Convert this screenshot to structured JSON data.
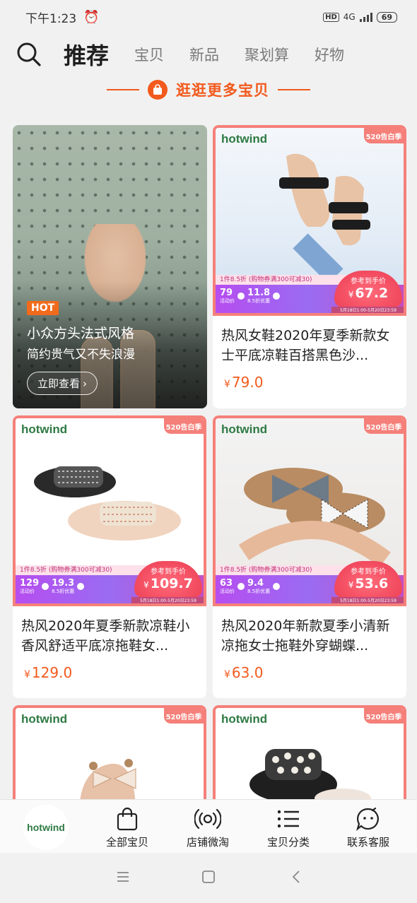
{
  "status_bar": {
    "time": "下午1:23",
    "network_label": "HD",
    "network_type": "4G",
    "battery": "69"
  },
  "header": {
    "tabs": [
      {
        "label": "推荐",
        "active": true
      },
      {
        "label": "宝贝",
        "active": false
      },
      {
        "label": "新品",
        "active": false
      },
      {
        "label": "聚划算",
        "active": false
      },
      {
        "label": "好物",
        "active": false
      }
    ]
  },
  "banner": {
    "text": "逛逛更多宝贝",
    "accent": "#f25a1d"
  },
  "hero": {
    "badge": "HOT",
    "title": "小众方头法式风格",
    "subtitle": "简约贵气又不失浪漫",
    "button": "立即查看"
  },
  "products": [
    {
      "brand": "hotwind",
      "tag": "520告白季",
      "promo_note": "1件8.5折 (购物券满300可减30)",
      "promo_a": "79",
      "promo_a_label": "活动价",
      "promo_b": "11.8",
      "promo_b_label": "8.5折优惠",
      "ref_label": "参考到手价",
      "ref_price": "67.2",
      "promo_date": "5月18日1:00-5月20日23:59",
      "title": "热风女鞋2020年夏季新款女士平底凉鞋百搭黑色沙...",
      "price": "79.0",
      "currency": "¥"
    },
    {
      "brand": "hotwind",
      "tag": "520告白季",
      "promo_note": "1件8.5折 (购物券满300可减30)",
      "promo_a": "129",
      "promo_a_label": "活动价",
      "promo_b": "19.3",
      "promo_b_label": "8.5折优惠",
      "ref_label": "参考到手价",
      "ref_price": "109.7",
      "promo_date": "5月18日1:00-5月20日23:59",
      "title": "热风2020年夏季新款凉鞋小香风舒适平底凉拖鞋女...",
      "price": "129.0",
      "currency": "¥"
    },
    {
      "brand": "hotwind",
      "tag": "520告白季",
      "promo_note": "1件8.5折 (购物券满300可减30)",
      "promo_a": "63",
      "promo_a_label": "活动价",
      "promo_b": "9.4",
      "promo_b_label": "8.5折优惠",
      "ref_label": "参考到手价",
      "ref_price": "53.6",
      "promo_date": "5月18日1:00-5月20日23:59",
      "title": "热风2020年新款夏季小清新凉拖女士拖鞋外穿蝴蝶...",
      "price": "63.0",
      "currency": "¥"
    },
    {
      "brand": "hotwind",
      "tag": "520告白季"
    },
    {
      "brand": "hotwind",
      "tag": "520告白季"
    }
  ],
  "bottom_nav": {
    "shop_logo": "hotwind",
    "items": [
      {
        "label": "全部宝贝",
        "icon": "shopping-bag-icon"
      },
      {
        "label": "店铺微淘",
        "icon": "broadcast-icon"
      },
      {
        "label": "宝贝分类",
        "icon": "list-icon"
      },
      {
        "label": "联系客服",
        "icon": "chat-bubble-icon"
      }
    ]
  }
}
